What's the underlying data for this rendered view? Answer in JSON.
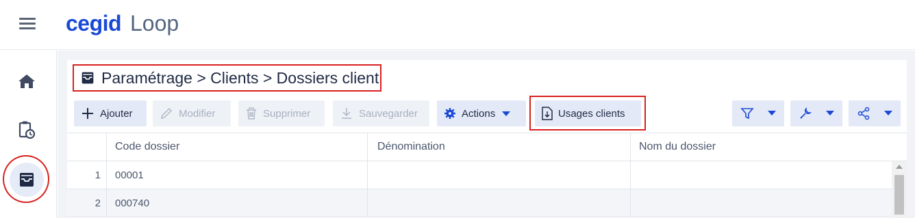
{
  "header": {
    "brand": "cegid",
    "product": "Loop"
  },
  "sidebar": {
    "items": [
      {
        "name": "home",
        "icon": "home-icon"
      },
      {
        "name": "tasks",
        "icon": "clipboard-clock-icon"
      },
      {
        "name": "inbox",
        "icon": "inbox-tray-icon",
        "active": true
      }
    ]
  },
  "page": {
    "breadcrumb": "Paramétrage > Clients > Dossiers client"
  },
  "toolbar": {
    "add_label": "Ajouter",
    "edit_label": "Modifier",
    "delete_label": "Supprimer",
    "save_label": "Sauvegarder",
    "actions_label": "Actions",
    "usages_label": "Usages clients"
  },
  "grid": {
    "columns": [
      "Code dossier",
      "Dénomination",
      "Nom du dossier"
    ],
    "rows": [
      {
        "num": "1",
        "code": "00001"
      },
      {
        "num": "2",
        "code": "000740"
      }
    ]
  },
  "colors": {
    "accent": "#1a49d6",
    "annotation": "#d8201e"
  }
}
